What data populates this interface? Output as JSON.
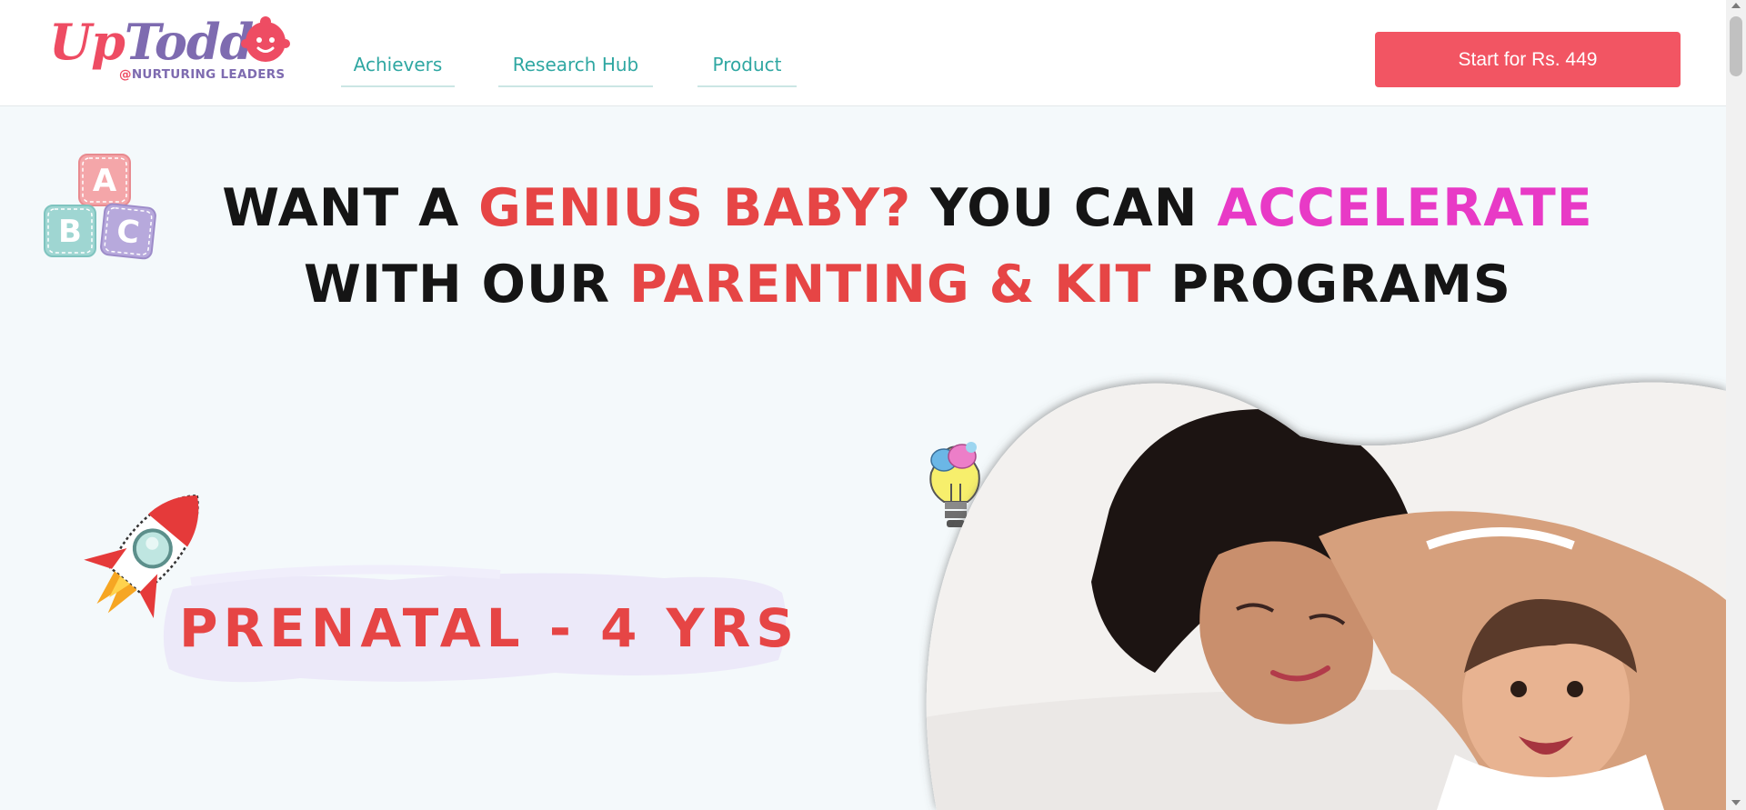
{
  "brand": {
    "logo_part1": "Up",
    "logo_part2": "Todd",
    "tagline_at": "@",
    "tagline": "NURTURING LEADERS"
  },
  "nav": {
    "items": [
      {
        "label": "Achievers"
      },
      {
        "label": "Research Hub"
      },
      {
        "label": "Product"
      }
    ]
  },
  "cta": {
    "label": "Start for Rs. 449"
  },
  "hero": {
    "line1": {
      "part1": "WANT A ",
      "highlight1": "GENIUS BABY?",
      "part2": " YOU CAN ",
      "highlight2": "ACCELERATE"
    },
    "line2": {
      "part1": "WITH OUR ",
      "highlight1": "PARENTING & KIT",
      "part2": " PROGRAMS"
    },
    "age_range": "PRENATAL - 4 YRS"
  },
  "decor": {
    "blocks_letters": [
      "A",
      "B",
      "C"
    ]
  },
  "colors": {
    "accent_red": "#e64545",
    "accent_pink": "#e83ac6",
    "nav_teal": "#2fa7a2",
    "cta_bg": "#f25563",
    "brand_purple": "#7e6bb0"
  },
  "icons": [
    "uptodd-baby-face-icon",
    "abc-blocks-icon",
    "rocket-icon",
    "lightbulb-brain-icon"
  ]
}
